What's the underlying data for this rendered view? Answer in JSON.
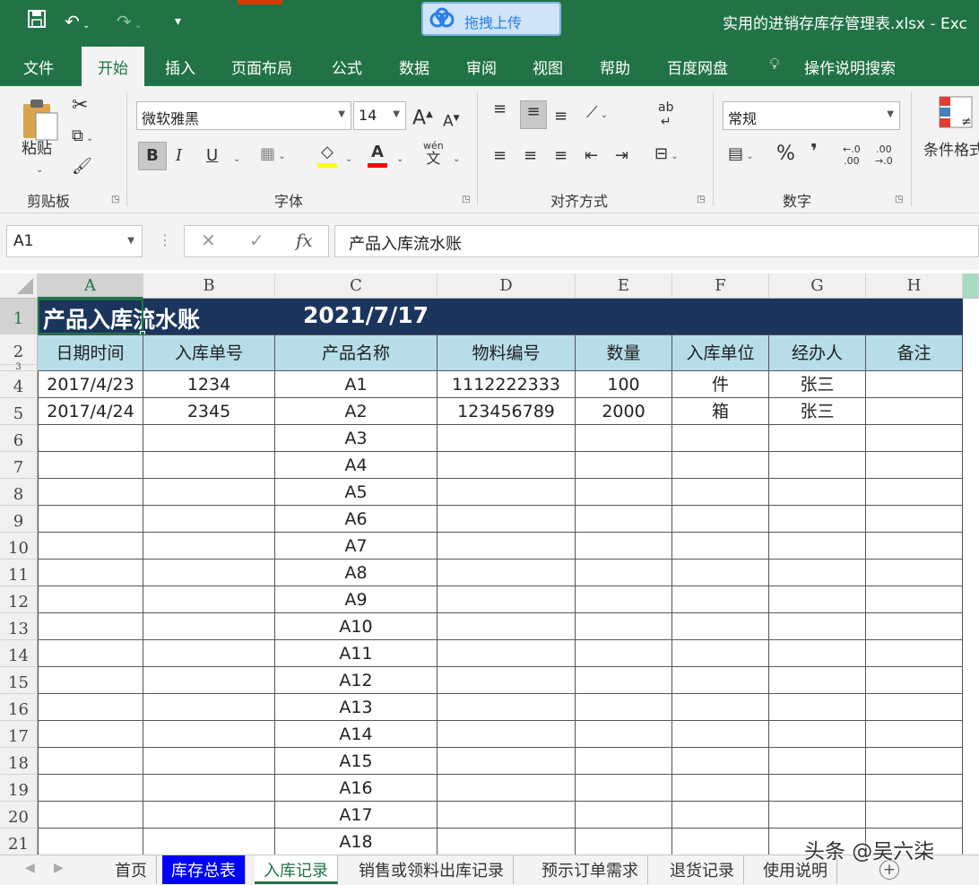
{
  "title_bar": {
    "document_title": "实用的进销存库存管理表.xlsx  -  Exc",
    "upload_button": "拖拽上传",
    "qat": {
      "save_icon": "save-icon",
      "undo_icon": "undo-icon",
      "redo_icon": "redo-icon",
      "customize_icon": "customize-qat-icon"
    }
  },
  "menu": {
    "tabs": [
      "文件",
      "开始",
      "插入",
      "页面布局",
      "公式",
      "数据",
      "审阅",
      "视图",
      "帮助",
      "百度网盘"
    ],
    "active_tab": "开始",
    "tell_me": "操作说明搜索"
  },
  "ribbon": {
    "clipboard": {
      "label": "剪贴板",
      "paste": "粘贴"
    },
    "font": {
      "label": "字体",
      "font_name": "微软雅黑",
      "font_size": "14",
      "grow": "A",
      "shrink": "A",
      "bold": "B",
      "italic": "I",
      "underline": "U",
      "font_color_letter": "A",
      "fill_color": "#ffff00",
      "font_color": "#ff0000",
      "phonetic": "wén"
    },
    "alignment": {
      "label": "对齐方式",
      "wrap": "ab"
    },
    "number": {
      "label": "数字",
      "format": "常规",
      "percent": "%",
      "comma": "，",
      "inc_decimal": "←.0\n.00",
      "dec_decimal": ".00\n→.0"
    },
    "styles": {
      "conditional_format": "条件格式"
    }
  },
  "formula_bar": {
    "name_box": "A1",
    "fx": "fx",
    "content": "产品入库流水账"
  },
  "sheet": {
    "columns": [
      "A",
      "B",
      "C",
      "D",
      "E",
      "F",
      "G",
      "H"
    ],
    "title": "产品入库流水账",
    "date": "2021/7/17",
    "headers": [
      "日期时间",
      "入库单号",
      "产品名称",
      "物料编号",
      "数量",
      "入库单位",
      "经办人",
      "备注"
    ],
    "row_numbers": [
      "1",
      "2",
      "3",
      "4",
      "5",
      "6",
      "7",
      "8",
      "9",
      "10",
      "11",
      "12",
      "13",
      "14",
      "15",
      "16",
      "17",
      "18",
      "19",
      "20",
      "21"
    ],
    "rows": [
      [
        "2017/4/23",
        "1234",
        "A1",
        "1112222333",
        "100",
        "件",
        "张三",
        ""
      ],
      [
        "2017/4/24",
        "2345",
        "A2",
        "123456789",
        "2000",
        "箱",
        "张三",
        ""
      ],
      [
        "",
        "",
        "A3",
        "",
        "",
        "",
        "",
        ""
      ],
      [
        "",
        "",
        "A4",
        "",
        "",
        "",
        "",
        ""
      ],
      [
        "",
        "",
        "A5",
        "",
        "",
        "",
        "",
        ""
      ],
      [
        "",
        "",
        "A6",
        "",
        "",
        "",
        "",
        ""
      ],
      [
        "",
        "",
        "A7",
        "",
        "",
        "",
        "",
        ""
      ],
      [
        "",
        "",
        "A8",
        "",
        "",
        "",
        "",
        ""
      ],
      [
        "",
        "",
        "A9",
        "",
        "",
        "",
        "",
        ""
      ],
      [
        "",
        "",
        "A10",
        "",
        "",
        "",
        "",
        ""
      ],
      [
        "",
        "",
        "A11",
        "",
        "",
        "",
        "",
        ""
      ],
      [
        "",
        "",
        "A12",
        "",
        "",
        "",
        "",
        ""
      ],
      [
        "",
        "",
        "A13",
        "",
        "",
        "",
        "",
        ""
      ],
      [
        "",
        "",
        "A14",
        "",
        "",
        "",
        "",
        ""
      ],
      [
        "",
        "",
        "A15",
        "",
        "",
        "",
        "",
        ""
      ],
      [
        "",
        "",
        "A16",
        "",
        "",
        "",
        "",
        ""
      ],
      [
        "",
        "",
        "A17",
        "",
        "",
        "",
        "",
        ""
      ],
      [
        "",
        "",
        "A18",
        "",
        "",
        "",
        "",
        ""
      ]
    ]
  },
  "sheet_tabs": [
    "首页",
    "库存总表",
    "入库记录",
    "销售或领料出库记录",
    "预示订单需求",
    "退货记录",
    "使用说明"
  ],
  "active_sheet": "入库记录",
  "watermark": "头条 @吴六柒",
  "colors": {
    "excel_green": "#217346",
    "title_fill": "#1b355d",
    "header_fill": "#b7dde8",
    "blue_tab": "#0000ff"
  }
}
